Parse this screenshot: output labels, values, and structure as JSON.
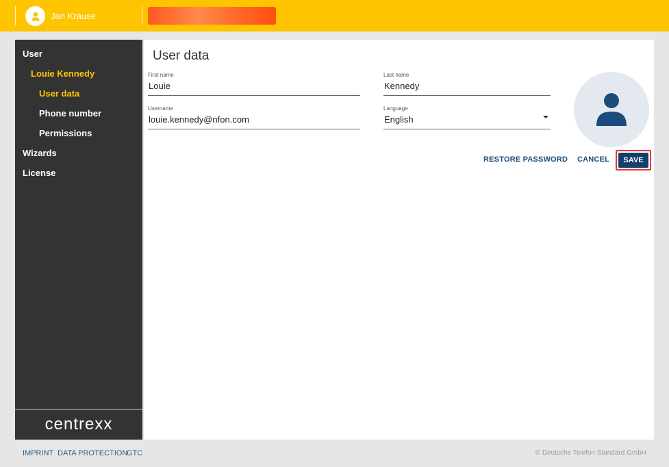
{
  "topbar": {
    "user_name": "Jan Krause",
    "bg_color": "#ffc400",
    "redacted_color": "#ff5a1f"
  },
  "sidebar": {
    "items": [
      {
        "label": "User",
        "level": 0,
        "active": false
      },
      {
        "label": "Louie Kennedy",
        "level": 1,
        "active": true
      },
      {
        "label": "User data",
        "level": 2,
        "active": true
      },
      {
        "label": "Phone number",
        "level": 2,
        "active": false
      },
      {
        "label": "Permissions",
        "level": 2,
        "active": false
      },
      {
        "label": "Wizards",
        "level": 0,
        "active": false
      },
      {
        "label": "License",
        "level": 0,
        "active": false
      }
    ],
    "logo": "centrexx",
    "bg_color": "#333333",
    "active_color": "#ffc400"
  },
  "main": {
    "title": "User data",
    "fields": {
      "first_name": {
        "label": "First name",
        "value": "Louie"
      },
      "last_name": {
        "label": "Last name",
        "value": "Kennedy"
      },
      "username": {
        "label": "Username",
        "value": "louie.kennedy@nfon.com"
      },
      "language": {
        "label": "Language",
        "value": "English"
      }
    },
    "avatar_icon": "person-icon",
    "buttons": {
      "restore_password": "RESTORE PASSWORD",
      "cancel": "CANCEL",
      "save": "SAVE"
    },
    "primary_color": "#12406b",
    "highlight_color": "#e0393e"
  },
  "footer": {
    "links": [
      "IMPRINT",
      "DATA PROTECTION",
      "GTC"
    ],
    "copyright": "© Deutsche Telefon Standard GmbH"
  }
}
